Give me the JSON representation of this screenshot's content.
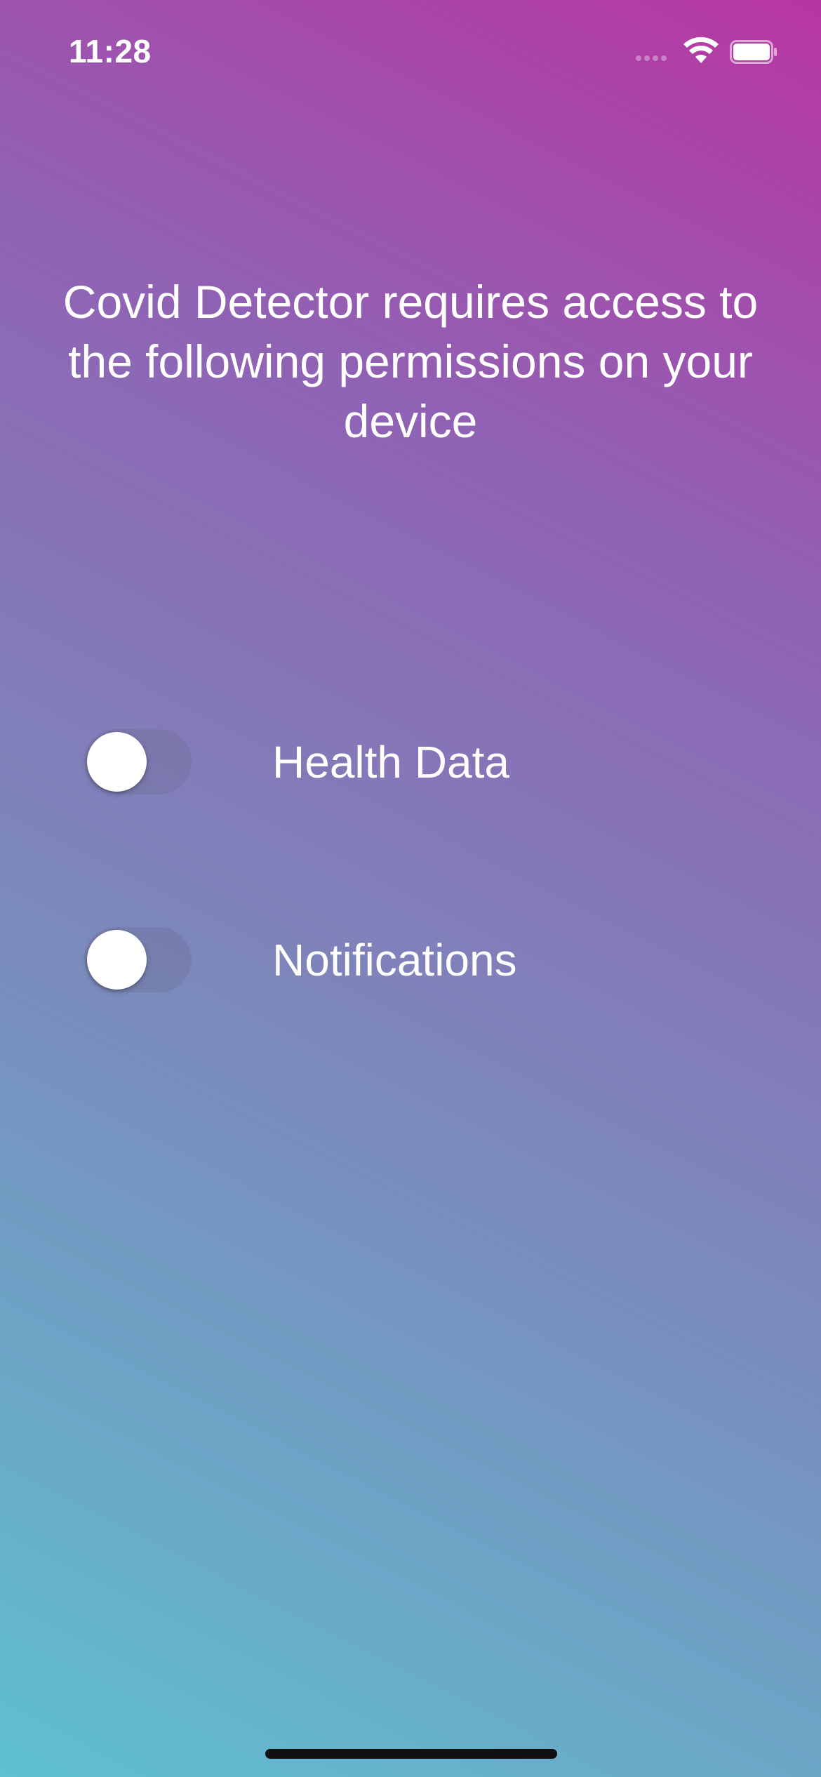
{
  "status_bar": {
    "time": "11:28",
    "icons": [
      "cellular-signal-icon",
      "wifi-icon",
      "battery-icon"
    ]
  },
  "screen": {
    "headline": "Covid Detector requires access to the following permissions on your device"
  },
  "permissions": [
    {
      "label": "Health Data",
      "enabled": false
    },
    {
      "label": "Notifications",
      "enabled": false
    }
  ],
  "colors": {
    "gradient_top_right": "#B836A2",
    "gradient_bottom_left": "#5EC0D2",
    "text": "#FFFFFF",
    "toggle_track_off": "#7A7AA0"
  }
}
